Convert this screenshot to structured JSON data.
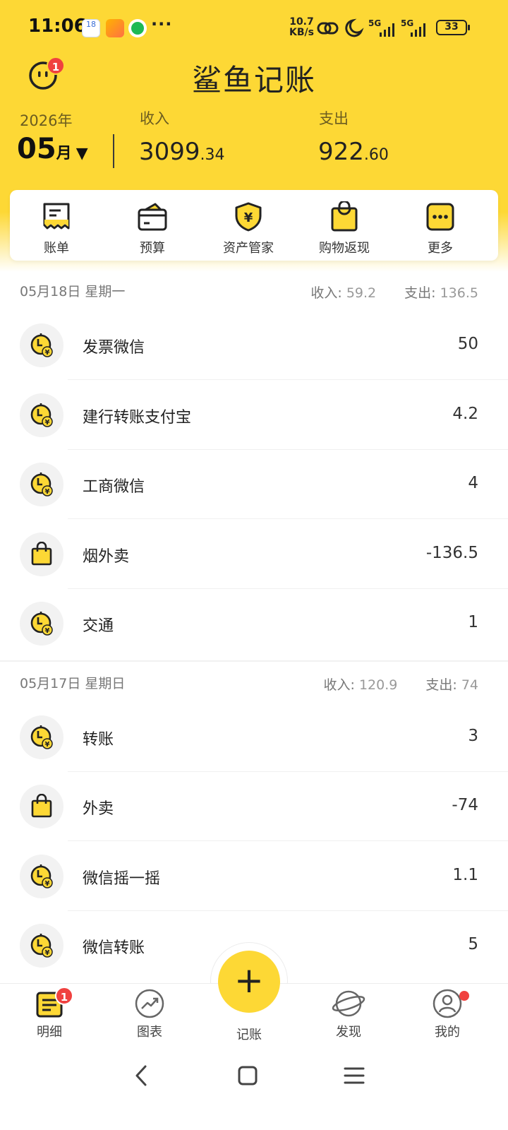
{
  "status_bar": {
    "time": "11:06",
    "calendar_day": "18",
    "more": "···",
    "net_speed_value": "10.7",
    "net_speed_unit": "KB/s",
    "signal_1": "5G",
    "signal_2": "5G",
    "battery": "33"
  },
  "header": {
    "title": "鲨鱼记账",
    "notification_badge": "1",
    "year": "2026年",
    "month_number": "05",
    "month_unit": "月",
    "income_label": "收入",
    "income_int": "3099",
    "income_dec": ".34",
    "expense_label": "支出",
    "expense_int": "922",
    "expense_dec": ".60"
  },
  "quick_menu": [
    {
      "label": "账单",
      "icon": "bill-icon"
    },
    {
      "label": "预算",
      "icon": "wallet-icon"
    },
    {
      "label": "资产管家",
      "icon": "shield-yuan-icon"
    },
    {
      "label": "购物返现",
      "icon": "shopping-bag-icon"
    },
    {
      "label": "更多",
      "icon": "more-icon"
    }
  ],
  "days": [
    {
      "date": "05月18日 星期一",
      "income_label": "收入:",
      "income": "59.2",
      "expense_label": "支出:",
      "expense": "136.5",
      "items": [
        {
          "name": "发票微信",
          "amount": "50",
          "icon": "clock-yuan-icon"
        },
        {
          "name": "建行转账支付宝",
          "amount": "4.2",
          "icon": "clock-yuan-icon"
        },
        {
          "name": "工商微信",
          "amount": "4",
          "icon": "clock-yuan-icon"
        },
        {
          "name": "烟外卖",
          "amount": "-136.5",
          "icon": "shopping-bag-icon"
        },
        {
          "name": "交通",
          "amount": "1",
          "icon": "clock-yuan-icon"
        }
      ]
    },
    {
      "date": "05月17日 星期日",
      "income_label": "收入:",
      "income": "120.9",
      "expense_label": "支出:",
      "expense": "74",
      "items": [
        {
          "name": "转账",
          "amount": "3",
          "icon": "clock-yuan-icon"
        },
        {
          "name": "外卖",
          "amount": "-74",
          "icon": "shopping-bag-icon"
        },
        {
          "name": "微信摇一摇",
          "amount": "1.1",
          "icon": "clock-yuan-icon"
        },
        {
          "name": "微信转账",
          "amount": "5",
          "icon": "clock-yuan-icon"
        }
      ]
    }
  ],
  "bottom_nav": {
    "items": [
      {
        "label": "明细",
        "icon": "list-icon",
        "badge": "1"
      },
      {
        "label": "图表",
        "icon": "trend-chart-icon"
      },
      {
        "label": "记账",
        "icon": "plus-icon"
      },
      {
        "label": "发现",
        "icon": "planet-icon"
      },
      {
        "label": "我的",
        "icon": "user-icon"
      }
    ],
    "fab_symbol": "+"
  },
  "colors": {
    "brand_yellow": "#FDD835",
    "badge_red": "#F0413F"
  }
}
